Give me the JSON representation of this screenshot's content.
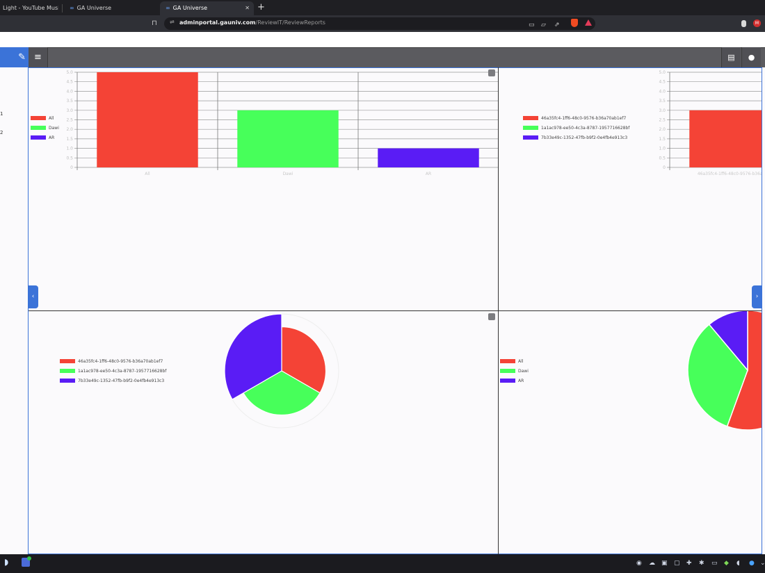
{
  "browser": {
    "tabs": [
      {
        "label": "Light - YouTube Music"
      },
      {
        "label": "GA Universe"
      },
      {
        "label": "GA Universe"
      }
    ],
    "tab_favicon": "∞",
    "new_tab": "+",
    "close_tab": "✕",
    "url_host": "adminportal.gauniv.com",
    "url_path": "/ReviewIT/ReviewReports"
  },
  "sidebar": {
    "labels": [
      "1",
      "2"
    ]
  },
  "charts": {
    "legend_a": [
      "All",
      "Dawi",
      "AR"
    ],
    "legend_b": [
      "46a35fc4-1ff6-48c0-9576-b36a70ab1ef7",
      "1a1ac978-ee50-4c3a-8787-1957716628bf",
      "7b33e49c-1352-47fb-b9f2-0e4fb4e913c3"
    ],
    "colors": {
      "red": "#f44336",
      "green": "#47ff5a",
      "blue": "#5a1cf5"
    }
  },
  "chart_data": [
    {
      "type": "bar",
      "categories": [
        "All",
        "Dawi",
        "AR"
      ],
      "values": [
        5,
        3,
        1
      ],
      "ylim": [
        0,
        5
      ],
      "yticks": [
        "0",
        "0.5",
        "1.0",
        "1.5",
        "2.0",
        "2.5",
        "3.0",
        "3.5",
        "4.0",
        "4.5",
        "5.0"
      ],
      "legend": [
        "All",
        "Dawi",
        "AR"
      ],
      "legend_position": "left",
      "grid": true
    },
    {
      "type": "bar",
      "categories": [
        "46a35fc4-1ff6-48c0-9576-b36a70ab1ef7"
      ],
      "values": [
        3
      ],
      "ylim": [
        0,
        5
      ],
      "yticks": [
        "0",
        "0.5",
        "1.0",
        "1.5",
        "2.0",
        "2.5",
        "3.0",
        "3.5",
        "4.0",
        "4.5",
        "5.0"
      ],
      "legend": [
        "46a35fc4-1ff6-48c0-9576-b36a70ab1ef7",
        "1a1ac978-ee50-4c3a-8787-1957716628bf",
        "7b33e49c-1352-47fb-b9f2-0e4fb4e913c3"
      ],
      "legend_position": "left",
      "grid": true
    },
    {
      "type": "pie",
      "variant": "polar-area",
      "categories": [
        "46a35fc4-1ff6-48c0-9576-b36a70ab1ef7",
        "1a1ac978-ee50-4c3a-8787-1957716628bf",
        "7b33e49c-1352-47fb-b9f2-0e4fb4e913c3"
      ],
      "values": [
        3,
        3,
        5
      ],
      "legend_position": "left"
    },
    {
      "type": "pie",
      "categories": [
        "All",
        "Dawi",
        "AR"
      ],
      "values": [
        5,
        3,
        1
      ],
      "legend_position": "left"
    }
  ],
  "icons": {
    "edit": "✎",
    "menu": "≡",
    "chat": "▤",
    "user": "●",
    "nav_left": "‹",
    "nav_right": "›",
    "bookmark": "⊓",
    "site_info": "⇌"
  }
}
